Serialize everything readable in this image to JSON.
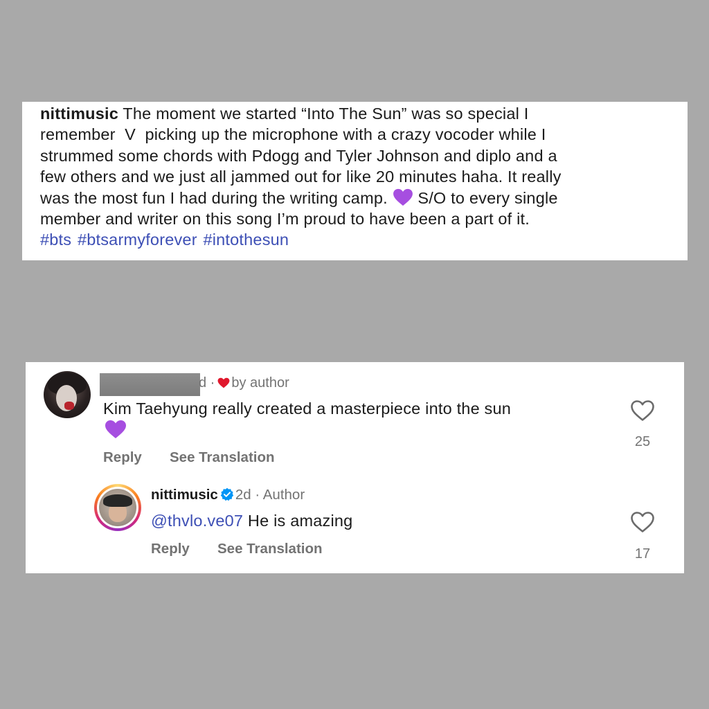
{
  "caption": {
    "username": "nittimusic",
    "lines": [
      "The moment we started “Into The Sun” was so special I",
      "remember  V  picking up the microphone with a crazy vocoder while I",
      "strummed some chords with Pdogg and Tyler Johnson and diplo and a",
      "few others and we just all jammed out for like 20 minutes haha. It really",
      "was the most fun I had during the writing camp.",
      "S/O to every single",
      "member and writer on this song I’m proud to have been a part of it."
    ],
    "hashtags": [
      "#bts",
      "#btsarmyforever",
      "#intothesun"
    ],
    "emoji": "purple-heart-icon"
  },
  "comment": {
    "meta_partial": "d ·",
    "liked_by": "by author",
    "text": "Kim Taehyung really created a masterpiece into the sun",
    "emoji": "purple-heart-icon",
    "like_count": "25",
    "reply_label": "Reply",
    "translate_label": "See Translation"
  },
  "reply": {
    "username": "nittimusic",
    "time": "2d",
    "separator": "·",
    "badge": "Author",
    "mention": "@thvlo.ve07",
    "text": "He is amazing",
    "like_count": "17",
    "reply_label": "Reply",
    "translate_label": "See Translation"
  },
  "colors": {
    "background": "#a9a9a9",
    "link": "#3d4fb5",
    "muted": "#737373",
    "purple_heart": "#a64ee0",
    "red_heart": "#e0182d",
    "verified": "#0095f6"
  }
}
